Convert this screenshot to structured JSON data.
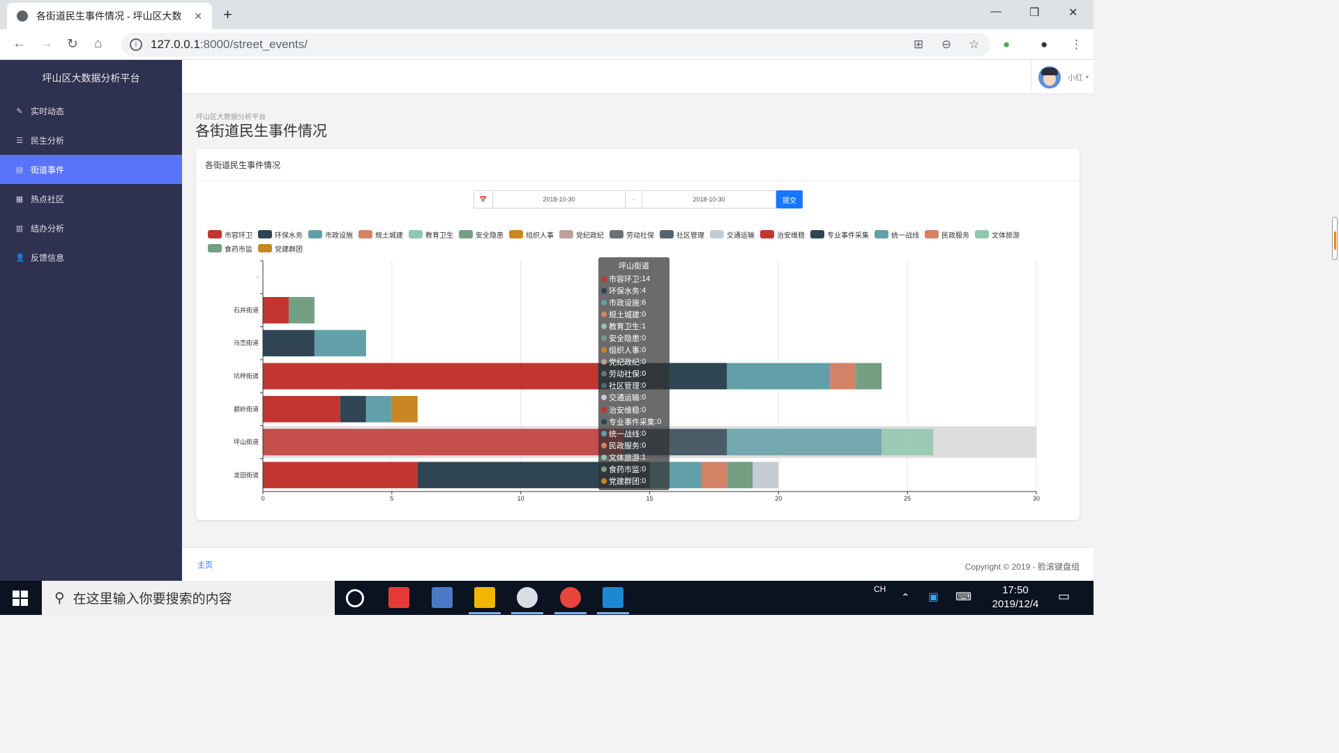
{
  "browser": {
    "tab_title": "各街道民生事件情况 - 坪山区大数",
    "tab_close": "✕",
    "new_tab": "+",
    "url_host": "127.0.0.1",
    "url_path": ":8000/street_events/",
    "win_min": "—",
    "win_max": "❐",
    "win_close": "✕"
  },
  "sidebar": {
    "title": "坪山区大数据分析平台",
    "items": [
      {
        "label": "实时动态",
        "icon": "pencil-icon",
        "glyph": "✎",
        "active": false
      },
      {
        "label": "民生分析",
        "icon": "list-icon",
        "glyph": "☰",
        "active": false
      },
      {
        "label": "街道事件",
        "icon": "file-icon",
        "glyph": "▤",
        "active": true
      },
      {
        "label": "热点社区",
        "icon": "grid-icon",
        "glyph": "▦",
        "active": false
      },
      {
        "label": "结办分析",
        "icon": "calendar-icon",
        "glyph": "▥",
        "active": false
      },
      {
        "label": "反馈信息",
        "icon": "user-icon",
        "glyph": "👤",
        "active": false
      }
    ]
  },
  "topbar": {
    "username": "小红",
    "caret": "▾"
  },
  "page": {
    "breadcrumb": "坪山区大数据分析平台",
    "title": "各街道民生事件情况",
    "panel_title": "各街道民生事件情况"
  },
  "form": {
    "date_icon": "📅",
    "start_date": "2018-10-30",
    "separator": "-",
    "end_date": "2018-10-30",
    "submit_label": "提交"
  },
  "chart_data": {
    "type": "bar",
    "orientation": "horizontal-stacked",
    "categories": [
      "-",
      "石井街道",
      "马峦街道",
      "坑梓街道",
      "碧岭街道",
      "坪山街道",
      "龙田街道"
    ],
    "xlim": [
      0,
      30
    ],
    "xticks": [
      0,
      5,
      10,
      15,
      20,
      25,
      30
    ],
    "grid": true,
    "legend_position": "top",
    "series": [
      {
        "name": "市容环卫",
        "color": "#c23531",
        "values": [
          0,
          1,
          0,
          13,
          3,
          14,
          6
        ]
      },
      {
        "name": "环保水务",
        "color": "#2f4554",
        "values": [
          0,
          0,
          2,
          5,
          1,
          4,
          9
        ]
      },
      {
        "name": "市政设施",
        "color": "#61a0a8",
        "values": [
          0,
          0,
          2,
          4,
          1,
          6,
          2
        ]
      },
      {
        "name": "规土城建",
        "color": "#d48265",
        "values": [
          0,
          0,
          0,
          1,
          0,
          0,
          1
        ]
      },
      {
        "name": "教育卫生",
        "color": "#91c7ae",
        "values": [
          0,
          0,
          0,
          0,
          0,
          1,
          0
        ]
      },
      {
        "name": "安全隐患",
        "color": "#749f83",
        "values": [
          0,
          1,
          0,
          1,
          0,
          0,
          1
        ]
      },
      {
        "name": "组织人事",
        "color": "#ca8622",
        "values": [
          0,
          0,
          0,
          0,
          1,
          0,
          0
        ]
      },
      {
        "name": "党纪政纪",
        "color": "#bda29a",
        "values": [
          0,
          0,
          0,
          0,
          0,
          0,
          0
        ]
      },
      {
        "name": "劳动社保",
        "color": "#6e7074",
        "values": [
          0,
          0,
          0,
          0,
          0,
          0,
          0
        ]
      },
      {
        "name": "社区管理",
        "color": "#546570",
        "values": [
          0,
          0,
          0,
          0,
          0,
          0,
          0
        ]
      },
      {
        "name": "交通运输",
        "color": "#c4ccd3",
        "values": [
          0,
          0,
          0,
          0,
          0,
          0,
          1
        ]
      },
      {
        "name": "治安维稳",
        "color": "#c23531",
        "values": [
          0,
          0,
          0,
          0,
          0,
          0,
          0
        ]
      },
      {
        "name": "专业事件采集",
        "color": "#2f4554",
        "values": [
          0,
          0,
          0,
          0,
          0,
          0,
          0
        ]
      },
      {
        "name": "统一战线",
        "color": "#61a0a8",
        "values": [
          0,
          0,
          0,
          0,
          0,
          0,
          0
        ]
      },
      {
        "name": "民政服务",
        "color": "#d48265",
        "values": [
          0,
          0,
          0,
          0,
          0,
          0,
          0
        ]
      },
      {
        "name": "文体旅游",
        "color": "#91c7ae",
        "values": [
          0,
          0,
          0,
          0,
          0,
          1,
          0
        ]
      },
      {
        "name": "食药市监",
        "color": "#749f83",
        "values": [
          0,
          0,
          0,
          0,
          0,
          0,
          0
        ]
      },
      {
        "name": "党建群团",
        "color": "#ca8622",
        "values": [
          0,
          0,
          0,
          0,
          0,
          0,
          0
        ]
      }
    ],
    "highlighted_category": "坪山街道",
    "tooltip": {
      "title": "坪山街道",
      "rows": [
        {
          "name": "市容环卫",
          "value": 14,
          "color": "#c23531"
        },
        {
          "name": "环保水务",
          "value": 4,
          "color": "#2f4554"
        },
        {
          "name": "市政设施",
          "value": 6,
          "color": "#61a0a8"
        },
        {
          "name": "规土城建",
          "value": 0,
          "color": "#d48265"
        },
        {
          "name": "教育卫生",
          "value": 1,
          "color": "#91c7ae"
        },
        {
          "name": "安全隐患",
          "value": 0,
          "color": "#749f83"
        },
        {
          "name": "组织人事",
          "value": 0,
          "color": "#ca8622"
        },
        {
          "name": "党纪政纪",
          "value": 0,
          "color": "#bda29a"
        },
        {
          "name": "劳动社保",
          "value": 0,
          "color": "#6e7074"
        },
        {
          "name": "社区管理",
          "value": 0,
          "color": "#546570"
        },
        {
          "name": "交通运输",
          "value": 0,
          "color": "#c4ccd3"
        },
        {
          "name": "治安维稳",
          "value": 0,
          "color": "#c23531"
        },
        {
          "name": "专业事件采集",
          "value": 0,
          "color": "#2f4554"
        },
        {
          "name": "统一战线",
          "value": 0,
          "color": "#61a0a8"
        },
        {
          "name": "民政服务",
          "value": 0,
          "color": "#d48265"
        },
        {
          "name": "文体旅游",
          "value": 1,
          "color": "#91c7ae"
        },
        {
          "name": "食药市监",
          "value": 0,
          "color": "#749f83"
        },
        {
          "name": "党建群团",
          "value": 0,
          "color": "#ca8622"
        }
      ]
    }
  },
  "footer": {
    "home_link": "主页",
    "copyright": "Copyright © 2019 - 脸滚键盘组"
  },
  "taskbar": {
    "search_placeholder": "在这里输入你要搜索的内容",
    "ime": "CH",
    "time": "17:50",
    "date": "2019/12/4"
  }
}
